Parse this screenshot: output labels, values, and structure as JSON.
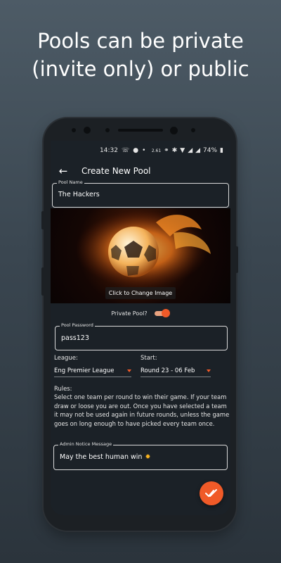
{
  "promo": {
    "line1": "Pools can be private",
    "line2": "(invite only) or public"
  },
  "status_bar": {
    "time": "14:32",
    "battery": "74%",
    "icons": [
      "whatsapp-icon",
      "pokeball-icon",
      "dot-icon",
      "data-speed-icon",
      "key-icon",
      "bluetooth-icon",
      "wifi-icon",
      "signal-icon",
      "signal-icon",
      "battery-icon"
    ]
  },
  "app_bar": {
    "back_icon": "arrow-left-icon",
    "title": "Create New Pool"
  },
  "pool_name": {
    "label": "Pool Name",
    "value": "The Hackers"
  },
  "image": {
    "change_label": "Click to Change Image"
  },
  "private_toggle": {
    "label": "Private Pool?",
    "on": true
  },
  "pool_password": {
    "label": "Pool Password",
    "value": "pass123"
  },
  "league": {
    "label": "League:",
    "value": "Eng Premier League"
  },
  "start": {
    "label": "Start:",
    "value": "Round 23 - 06 Feb"
  },
  "rules": {
    "label": "Rules:",
    "text": "Select one team per round to win their game. If your team draw or loose you are out. Once you have selected a team it may not be used again in future rounds, unless the game goes on long enough to have picked every team once."
  },
  "admin_notice": {
    "label": "Admin Notice Message",
    "value": "May the best human win"
  },
  "fab": {
    "icon": "double-check-icon"
  },
  "colors": {
    "accent": "#f05a28",
    "screen_bg": "#1b2127"
  }
}
